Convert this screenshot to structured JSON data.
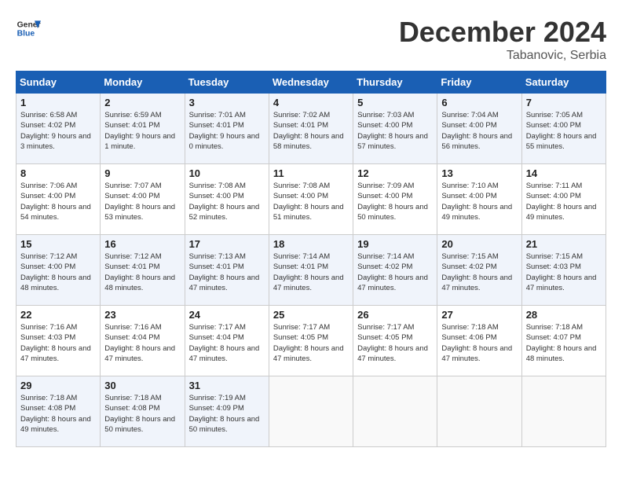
{
  "header": {
    "logo_line1": "General",
    "logo_line2": "Blue",
    "month_title": "December 2024",
    "location": "Tabanovic, Serbia"
  },
  "days_of_week": [
    "Sunday",
    "Monday",
    "Tuesday",
    "Wednesday",
    "Thursday",
    "Friday",
    "Saturday"
  ],
  "weeks": [
    [
      {
        "day": "1",
        "sunrise": "Sunrise: 6:58 AM",
        "sunset": "Sunset: 4:02 PM",
        "daylight": "Daylight: 9 hours and 3 minutes."
      },
      {
        "day": "2",
        "sunrise": "Sunrise: 6:59 AM",
        "sunset": "Sunset: 4:01 PM",
        "daylight": "Daylight: 9 hours and 1 minute."
      },
      {
        "day": "3",
        "sunrise": "Sunrise: 7:01 AM",
        "sunset": "Sunset: 4:01 PM",
        "daylight": "Daylight: 9 hours and 0 minutes."
      },
      {
        "day": "4",
        "sunrise": "Sunrise: 7:02 AM",
        "sunset": "Sunset: 4:01 PM",
        "daylight": "Daylight: 8 hours and 58 minutes."
      },
      {
        "day": "5",
        "sunrise": "Sunrise: 7:03 AM",
        "sunset": "Sunset: 4:00 PM",
        "daylight": "Daylight: 8 hours and 57 minutes."
      },
      {
        "day": "6",
        "sunrise": "Sunrise: 7:04 AM",
        "sunset": "Sunset: 4:00 PM",
        "daylight": "Daylight: 8 hours and 56 minutes."
      },
      {
        "day": "7",
        "sunrise": "Sunrise: 7:05 AM",
        "sunset": "Sunset: 4:00 PM",
        "daylight": "Daylight: 8 hours and 55 minutes."
      }
    ],
    [
      {
        "day": "8",
        "sunrise": "Sunrise: 7:06 AM",
        "sunset": "Sunset: 4:00 PM",
        "daylight": "Daylight: 8 hours and 54 minutes."
      },
      {
        "day": "9",
        "sunrise": "Sunrise: 7:07 AM",
        "sunset": "Sunset: 4:00 PM",
        "daylight": "Daylight: 8 hours and 53 minutes."
      },
      {
        "day": "10",
        "sunrise": "Sunrise: 7:08 AM",
        "sunset": "Sunset: 4:00 PM",
        "daylight": "Daylight: 8 hours and 52 minutes."
      },
      {
        "day": "11",
        "sunrise": "Sunrise: 7:08 AM",
        "sunset": "Sunset: 4:00 PM",
        "daylight": "Daylight: 8 hours and 51 minutes."
      },
      {
        "day": "12",
        "sunrise": "Sunrise: 7:09 AM",
        "sunset": "Sunset: 4:00 PM",
        "daylight": "Daylight: 8 hours and 50 minutes."
      },
      {
        "day": "13",
        "sunrise": "Sunrise: 7:10 AM",
        "sunset": "Sunset: 4:00 PM",
        "daylight": "Daylight: 8 hours and 49 minutes."
      },
      {
        "day": "14",
        "sunrise": "Sunrise: 7:11 AM",
        "sunset": "Sunset: 4:00 PM",
        "daylight": "Daylight: 8 hours and 49 minutes."
      }
    ],
    [
      {
        "day": "15",
        "sunrise": "Sunrise: 7:12 AM",
        "sunset": "Sunset: 4:00 PM",
        "daylight": "Daylight: 8 hours and 48 minutes."
      },
      {
        "day": "16",
        "sunrise": "Sunrise: 7:12 AM",
        "sunset": "Sunset: 4:01 PM",
        "daylight": "Daylight: 8 hours and 48 minutes."
      },
      {
        "day": "17",
        "sunrise": "Sunrise: 7:13 AM",
        "sunset": "Sunset: 4:01 PM",
        "daylight": "Daylight: 8 hours and 47 minutes."
      },
      {
        "day": "18",
        "sunrise": "Sunrise: 7:14 AM",
        "sunset": "Sunset: 4:01 PM",
        "daylight": "Daylight: 8 hours and 47 minutes."
      },
      {
        "day": "19",
        "sunrise": "Sunrise: 7:14 AM",
        "sunset": "Sunset: 4:02 PM",
        "daylight": "Daylight: 8 hours and 47 minutes."
      },
      {
        "day": "20",
        "sunrise": "Sunrise: 7:15 AM",
        "sunset": "Sunset: 4:02 PM",
        "daylight": "Daylight: 8 hours and 47 minutes."
      },
      {
        "day": "21",
        "sunrise": "Sunrise: 7:15 AM",
        "sunset": "Sunset: 4:03 PM",
        "daylight": "Daylight: 8 hours and 47 minutes."
      }
    ],
    [
      {
        "day": "22",
        "sunrise": "Sunrise: 7:16 AM",
        "sunset": "Sunset: 4:03 PM",
        "daylight": "Daylight: 8 hours and 47 minutes."
      },
      {
        "day": "23",
        "sunrise": "Sunrise: 7:16 AM",
        "sunset": "Sunset: 4:04 PM",
        "daylight": "Daylight: 8 hours and 47 minutes."
      },
      {
        "day": "24",
        "sunrise": "Sunrise: 7:17 AM",
        "sunset": "Sunset: 4:04 PM",
        "daylight": "Daylight: 8 hours and 47 minutes."
      },
      {
        "day": "25",
        "sunrise": "Sunrise: 7:17 AM",
        "sunset": "Sunset: 4:05 PM",
        "daylight": "Daylight: 8 hours and 47 minutes."
      },
      {
        "day": "26",
        "sunrise": "Sunrise: 7:17 AM",
        "sunset": "Sunset: 4:05 PM",
        "daylight": "Daylight: 8 hours and 47 minutes."
      },
      {
        "day": "27",
        "sunrise": "Sunrise: 7:18 AM",
        "sunset": "Sunset: 4:06 PM",
        "daylight": "Daylight: 8 hours and 47 minutes."
      },
      {
        "day": "28",
        "sunrise": "Sunrise: 7:18 AM",
        "sunset": "Sunset: 4:07 PM",
        "daylight": "Daylight: 8 hours and 48 minutes."
      }
    ],
    [
      {
        "day": "29",
        "sunrise": "Sunrise: 7:18 AM",
        "sunset": "Sunset: 4:08 PM",
        "daylight": "Daylight: 8 hours and 49 minutes."
      },
      {
        "day": "30",
        "sunrise": "Sunrise: 7:18 AM",
        "sunset": "Sunset: 4:08 PM",
        "daylight": "Daylight: 8 hours and 50 minutes."
      },
      {
        "day": "31",
        "sunrise": "Sunrise: 7:19 AM",
        "sunset": "Sunset: 4:09 PM",
        "daylight": "Daylight: 8 hours and 50 minutes."
      },
      null,
      null,
      null,
      null
    ]
  ]
}
